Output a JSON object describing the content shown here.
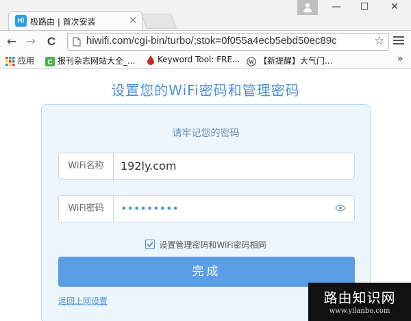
{
  "browser": {
    "tab": {
      "favicon_text": "Hi",
      "title": "极路由 | 首次安装",
      "close": "×"
    },
    "window_controls": {
      "minimize": "—",
      "maximize": "☐",
      "close": "✕"
    },
    "toolbar": {
      "back": "←",
      "forward": "→",
      "reload": "C",
      "url": "hiwifi.com/cgi-bin/turbo/;stok=0f055a4ecb5ebd50ec89c",
      "star": "☆"
    },
    "bookmarks": [
      {
        "label": "应用",
        "icon": "apps-grid-icon"
      },
      {
        "label": "报刊杂志网站大全_...",
        "icon": "green-c-icon"
      },
      {
        "label": "Keyword Tool: FRE...",
        "icon": "red-drop-icon"
      },
      {
        "label": "【新提醒】大气门...",
        "icon": "wordpress-icon"
      }
    ],
    "bookmarks_overflow": "»"
  },
  "page": {
    "title": "设置您的WiFi密码和管理密码",
    "subtitle": "请牢记您的密码",
    "wifi_name": {
      "label": "WiFi名称",
      "value": "192ly.com"
    },
    "wifi_password": {
      "label": "WiFi密码",
      "value": "•••••••••"
    },
    "same_password_checkbox": {
      "label": "设置管理密码和WiFi密码相同",
      "checked": true
    },
    "submit_label": "完成",
    "back_link": "返回上网设置"
  },
  "watermark": {
    "title": "路由知识网",
    "url": "www.yilanbo.com"
  },
  "colors": {
    "accent": "#4a90d9",
    "button": "#5b9ee8",
    "card_bg": "#eef6fd"
  }
}
